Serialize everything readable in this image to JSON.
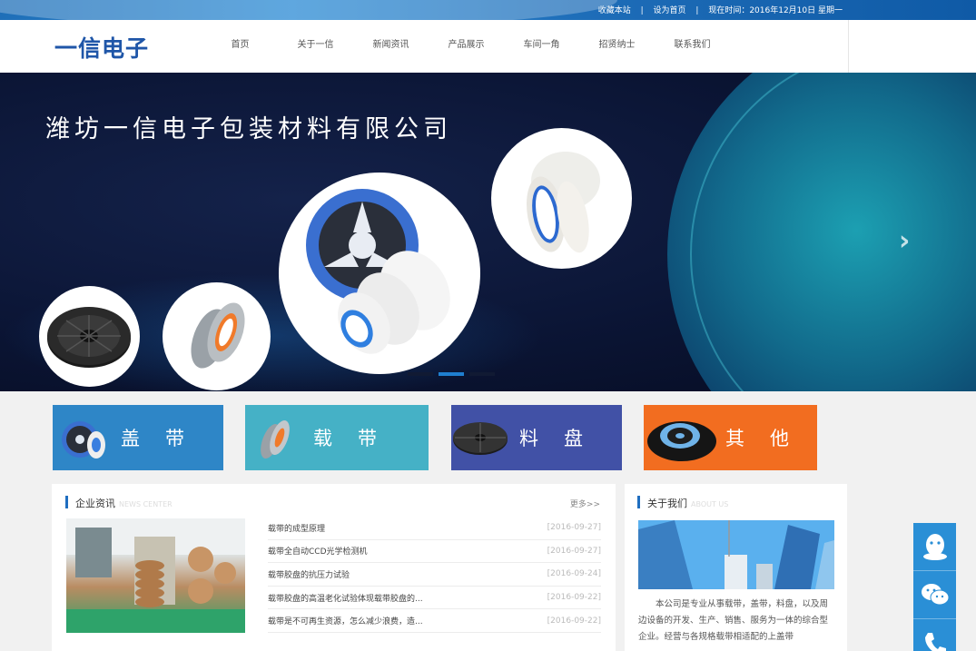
{
  "topbar": {
    "favorite": "收藏本站",
    "sep1": "|",
    "set_home": "设为首页",
    "sep2": "|",
    "datetime": "现在时间：2016年12月10日 星期一"
  },
  "logo": "一信电子",
  "nav": [
    "首页",
    "关于一信",
    "新闻资讯",
    "产品展示",
    "车间一角",
    "招贤纳士",
    "联系我们"
  ],
  "banner": {
    "title": "潍坊一信电子包装材料有限公司",
    "next_arrow": "›",
    "slides": 3,
    "active_slide": 2
  },
  "categories": [
    {
      "label": "盖带",
      "color": "#2e86c7"
    },
    {
      "label": "载带",
      "color": "#45b1c6"
    },
    {
      "label": "料盘",
      "color": "#4151a6"
    },
    {
      "label": "其他",
      "color": "#f26d20"
    }
  ],
  "news": {
    "title": "企业资讯",
    "title_en": "NEWS CENTER",
    "more": "更多>>",
    "items": [
      {
        "title": "载带的成型原理",
        "date": "[2016-09-27]"
      },
      {
        "title": "载带全自动CCD光学检测机",
        "date": "[2016-09-27]"
      },
      {
        "title": "载带胶盘的抗压力试验",
        "date": "[2016-09-24]"
      },
      {
        "title": "载带胶盘的高温老化试验体现载带胶盘的...",
        "date": "[2016-09-22]"
      },
      {
        "title": "载带是不可再生资源，怎么减少浪费，造...",
        "date": "[2016-09-22]"
      }
    ]
  },
  "about": {
    "title": "关于我们",
    "title_en": "ABOUT US",
    "text": "本公司是专业从事载带，盖带，料盘，以及周边设备的开发、生产、销售、服务为一体的综合型企业。经营与各规格载带相适配的上盖带"
  },
  "side_float": [
    "qq-icon",
    "wechat-icon",
    "phone-icon"
  ],
  "colors": {
    "accent": "#1f6ec0",
    "topbar": "#1f6fb8",
    "float": "#2a8fd6"
  }
}
